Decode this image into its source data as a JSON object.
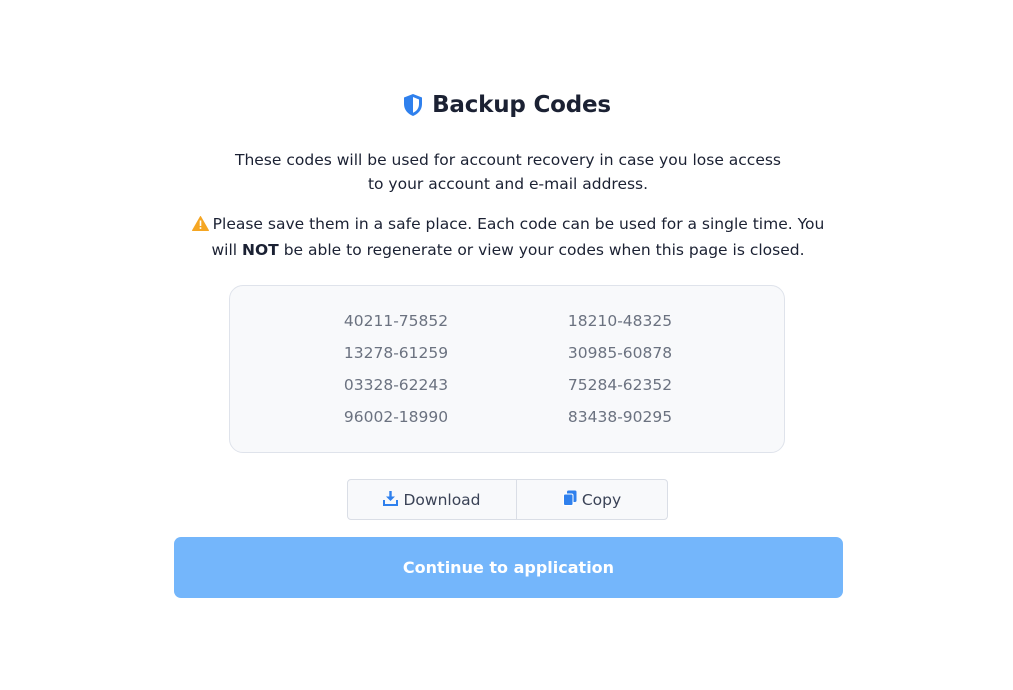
{
  "header": {
    "title": "Backup Codes",
    "icon": "shield-icon",
    "icon_color": "#2f80ed"
  },
  "description": {
    "line1": "These codes will be used for account recovery in case you lose access",
    "line2": "to your account and e-mail address."
  },
  "warning": {
    "icon": "warning-icon",
    "icon_color": "#f5a623",
    "text_part1": "Please save them in a safe place. Each code can be used for a single time. You",
    "text_part2": "will",
    "emphasis": "NOT",
    "text_part3": "be able to regenerate or view your codes when this page is closed."
  },
  "codes": [
    [
      "40211-75852",
      "18210-48325"
    ],
    [
      "13278-61259",
      "30985-60878"
    ],
    [
      "03328-62243",
      "75284-62352"
    ],
    [
      "96002-18990",
      "83438-90295"
    ]
  ],
  "actions": {
    "download_label": "Download",
    "download_icon": "download-icon",
    "copy_label": "Copy",
    "copy_icon": "copy-icon",
    "continue_label": "Continue to application"
  },
  "colors": {
    "accent": "#2f80ed",
    "primary_button": "#74b6fb"
  }
}
